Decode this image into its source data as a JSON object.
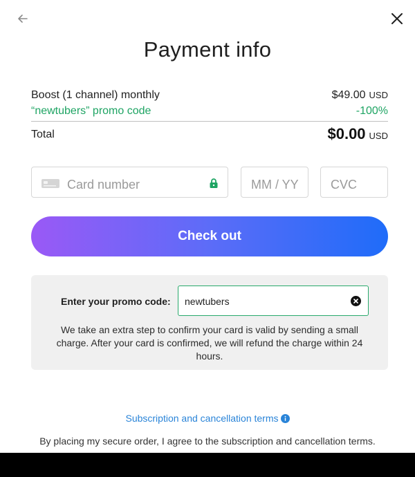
{
  "header": {
    "back_icon": "arrow-left-icon",
    "close_icon": "close-icon",
    "title": "Payment info"
  },
  "summary": {
    "plan_label": "Boost (1 channel) monthly",
    "plan_price": "$49.00",
    "plan_currency": "USD",
    "promo_label": "“newtubers” promo code",
    "promo_discount": "-100%",
    "total_label": "Total",
    "total_value": "$0.00",
    "total_currency": "USD"
  },
  "payment_fields": {
    "card_placeholder": "Card number",
    "card_icon": "credit-card-icon",
    "lock_icon": "lock-icon",
    "expiry_placeholder": "MM / YY",
    "cvc_placeholder": "CVC"
  },
  "checkout": {
    "label": "Check out"
  },
  "promo": {
    "label": "Enter your promo code:",
    "value": "newtubers",
    "clear_icon": "clear-circle-icon",
    "note": "We take an extra step to confirm your card is valid by sending a small charge. After your card is confirmed, we will refund the charge within 24 hours."
  },
  "footer": {
    "terms_link": "Subscription and cancellation terms",
    "info_icon": "info-icon",
    "agreement": "By placing my secure order, I agree to the subscription and cancellation terms."
  },
  "colors": {
    "promo_green": "#1ea463",
    "link_blue": "#2a84d8",
    "button_gradient_start": "#9a59f6",
    "button_gradient_end": "#1f6cf9"
  }
}
